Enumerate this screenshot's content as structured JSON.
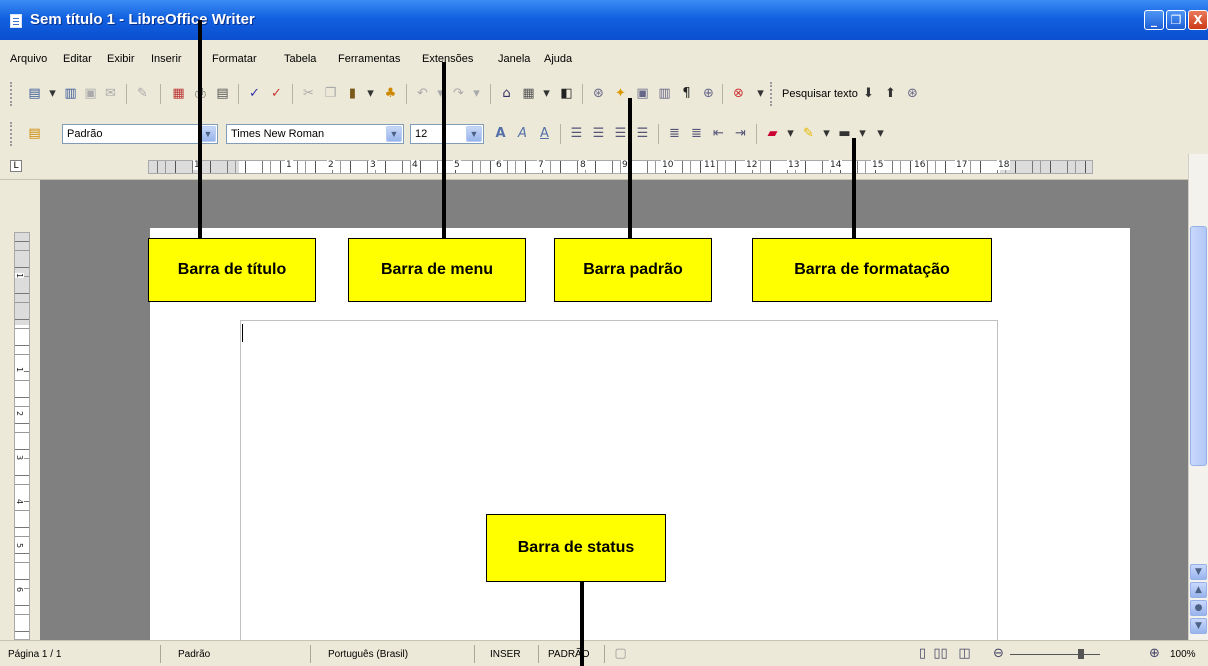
{
  "window": {
    "title": "Sem título 1 - LibreOffice Writer",
    "buttons": [
      "_",
      "❐",
      "X"
    ]
  },
  "menu": [
    "Arquivo",
    "Editar",
    "Exibir",
    "Inserir",
    "Formatar",
    "Tabela",
    "Ferramentas",
    "Extensões",
    "Janela",
    "Ajuda"
  ],
  "standard_toolbar": {
    "search_label": "Pesquisar texto"
  },
  "formatting_toolbar": {
    "style_value": "Padrão",
    "font_value": "Times New Roman",
    "size_value": "12"
  },
  "ruler": {
    "h_labels": [
      "1",
      "1",
      "2",
      "3",
      "4",
      "5",
      "6",
      "7",
      "8",
      "9",
      "10",
      "11",
      "12",
      "13",
      "14",
      "15",
      "16",
      "17",
      "18"
    ],
    "v_labels": [
      "1",
      "1",
      "2",
      "3",
      "4",
      "5",
      "6"
    ]
  },
  "status": {
    "page": "Página 1 / 1",
    "style": "Padrão",
    "language": "Português (Brasil)",
    "insert_mode": "INSER",
    "selection_mode": "PADRÃO",
    "zoom": "100%"
  },
  "annotations": {
    "title_bar": "Barra de título",
    "menu_bar": "Barra de menu",
    "standard_bar": "Barra padrão",
    "formatting_bar": "Barra de formatação",
    "status_bar": "Barra de status"
  }
}
